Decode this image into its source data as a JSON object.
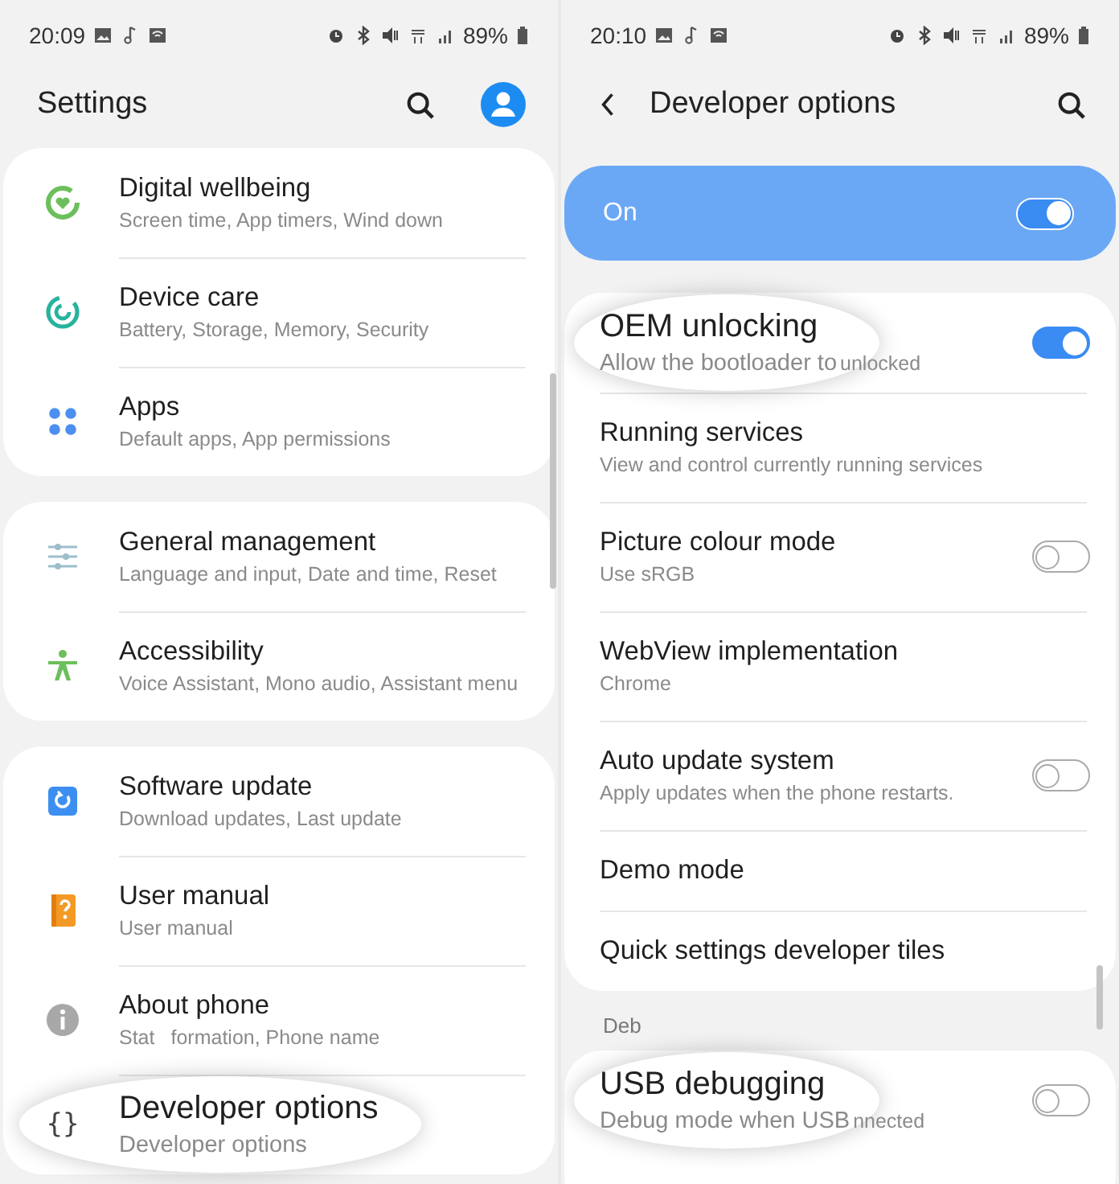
{
  "left": {
    "status": {
      "time": "20:09",
      "battery": "89%"
    },
    "title": "Settings",
    "cards": [
      {
        "rows": [
          {
            "kind": "row",
            "title": "Digital wellbeing",
            "subtitle": "Screen time, App timers, Wind down"
          },
          {
            "kind": "row",
            "title": "Device care",
            "subtitle": "Battery, Storage, Memory, Security"
          },
          {
            "kind": "row",
            "title": "Apps",
            "subtitle": "Default apps, App permissions"
          }
        ]
      },
      {
        "rows": [
          {
            "kind": "row",
            "title": "General management",
            "subtitle": "Language and input, Date and time, Reset"
          },
          {
            "kind": "row",
            "title": "Accessibility",
            "subtitle": "Voice Assistant, Mono audio, Assistant menu"
          }
        ]
      },
      {
        "rows": [
          {
            "kind": "row",
            "title": "Software update",
            "subtitle": "Download updates, Last update"
          },
          {
            "kind": "row",
            "title": "User manual",
            "subtitle": "User manual"
          },
          {
            "kind": "row",
            "title": "About phone",
            "subtitle": "Stat",
            "subtitle_tail": "formation, Phone name"
          },
          {
            "kind": "magnified",
            "glyph": "{}",
            "title": "Developer options",
            "subtitle": "Developer options"
          }
        ]
      }
    ]
  },
  "right": {
    "status": {
      "time": "20:10",
      "battery": "89%"
    },
    "title": "Developer options",
    "master": {
      "label": "On",
      "on": true
    },
    "cards": [
      {
        "rows": [
          {
            "kind": "magnified",
            "title": "OEM unlocking",
            "subtitle": "Allow the bootloader to",
            "subtitle_tail": "unlocked",
            "on": true
          },
          {
            "kind": "row",
            "title": "Running services",
            "subtitle": "View and control currently running services"
          },
          {
            "kind": "row",
            "title": "Picture colour mode",
            "subtitle": "Use sRGB",
            "on": false
          },
          {
            "kind": "row",
            "title": "WebView implementation",
            "subtitle": "Chrome"
          },
          {
            "kind": "row",
            "title": "Auto update system",
            "subtitle": "Apply updates when the phone restarts.",
            "on": false
          },
          {
            "kind": "row",
            "title": "Demo mode"
          },
          {
            "kind": "row",
            "title": "Quick settings developer tiles"
          }
        ]
      },
      {
        "header": "Deb",
        "rows": [
          {
            "kind": "magnified",
            "title": "USB debugging",
            "subtitle": "Debug mode when USB",
            "subtitle_tail": "nnected",
            "on": false
          }
        ]
      }
    ]
  }
}
